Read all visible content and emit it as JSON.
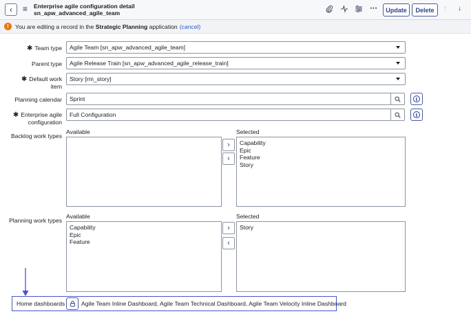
{
  "header": {
    "title_line1": "Enterprise agile configuration detail",
    "title_line2": "sn_apw_advanced_agile_team",
    "update_label": "Update",
    "delete_label": "Delete",
    "icons": [
      "paperclip-icon",
      "activity-icon",
      "sliders-icon",
      "more-icon",
      "arrow-up-icon",
      "arrow-down-icon"
    ]
  },
  "infobar": {
    "prefix": "You are editing a record in the",
    "app_name": "Strategic Planning",
    "suffix": "application",
    "cancel": "(cancel)"
  },
  "form": {
    "team_type": {
      "label": "Team type",
      "value": "Agile Team [sn_apw_advanced_agile_team]"
    },
    "parent_type": {
      "label": "Parent type",
      "value": "Agile Release Train [sn_apw_advanced_agile_release_train]"
    },
    "default_work_item": {
      "label_line1": "Default work",
      "label_line2": "item",
      "value": "Story [rm_story]"
    },
    "planning_calendar": {
      "label": "Planning calendar",
      "value": "Sprint"
    },
    "enterprise_agile_config": {
      "label_line1": "Enterprise agile",
      "label_line2": "configuration",
      "value": "Full Configuration"
    },
    "backlog_work_types": {
      "label": "Backlog work types",
      "available_caption": "Available",
      "selected_caption": "Selected",
      "available": [],
      "selected": [
        "Capability",
        "Epic",
        "Feature",
        "Story"
      ]
    },
    "planning_work_types": {
      "label": "Planning work types",
      "available_caption": "Available",
      "selected_caption": "Selected",
      "available": [
        "Capability",
        "Epic",
        "Feature"
      ],
      "selected": [
        "Story"
      ]
    },
    "home_dashboards": {
      "label": "Home dashboards",
      "value": "Agile Team Inline Dashboard, Agile Team Technical Dashboard, Agile Team Velocity Inline Dashboard"
    }
  },
  "colors": {
    "accent": "#4754c9",
    "warning": "#e8780f",
    "link": "#2b57c4"
  }
}
